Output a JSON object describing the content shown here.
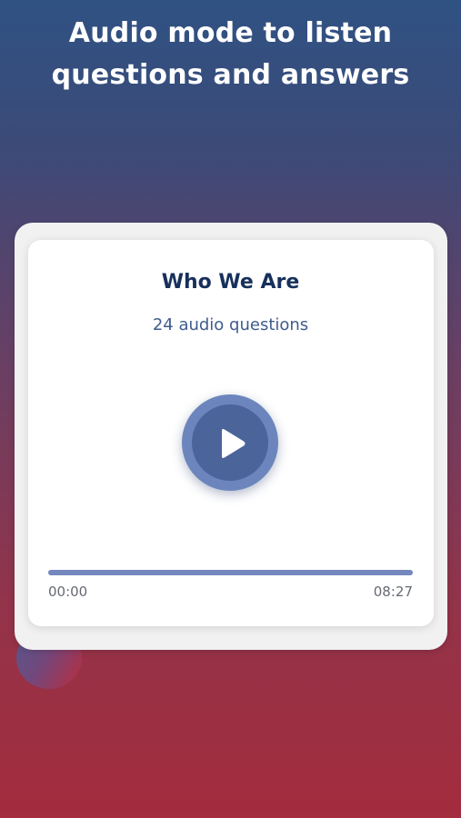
{
  "headline": {
    "line1": "Audio mode to listen",
    "line2": "questions and answers"
  },
  "card": {
    "title": "Who We Are",
    "subtitle": "24 audio questions"
  },
  "player": {
    "play_icon": "play-icon",
    "progress_fraction": 1.0,
    "time_elapsed": "00:00",
    "time_total": "08:27"
  },
  "colors": {
    "background_top": "#2f5283",
    "background_bottom": "#a32c3d",
    "accent": "#4b6499",
    "accent_light": "#6c86bd",
    "progress_fill": "#7488bd",
    "title_text": "#17305b"
  }
}
